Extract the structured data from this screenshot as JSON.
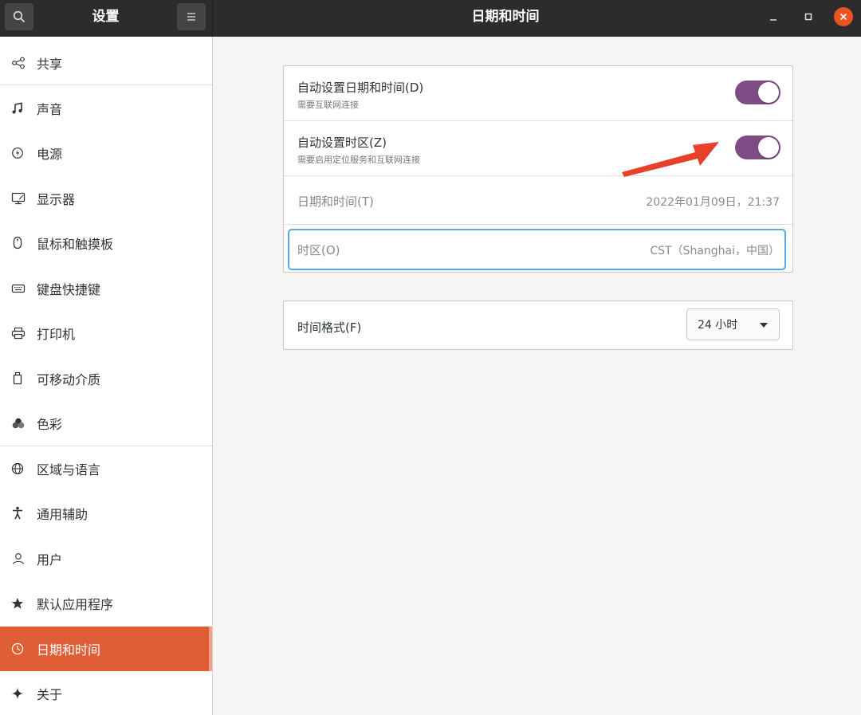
{
  "header": {
    "sidebar_title": "设置",
    "main_title": "日期和时间"
  },
  "sidebar": {
    "items": [
      {
        "label": "共享",
        "icon": "share-icon"
      },
      {
        "label": "声音",
        "icon": "music-note-icon"
      },
      {
        "label": "电源",
        "icon": "power-icon"
      },
      {
        "label": "显示器",
        "icon": "monitor-icon"
      },
      {
        "label": "鼠标和触摸板",
        "icon": "mouse-icon"
      },
      {
        "label": "键盘快捷键",
        "icon": "keyboard-icon"
      },
      {
        "label": "打印机",
        "icon": "printer-icon"
      },
      {
        "label": "可移动介质",
        "icon": "removable-media-icon"
      },
      {
        "label": "色彩",
        "icon": "color-icon"
      },
      {
        "label": "区域与语言",
        "icon": "globe-icon"
      },
      {
        "label": "通用辅助",
        "icon": "accessibility-icon"
      },
      {
        "label": "用户",
        "icon": "user-icon"
      },
      {
        "label": "默认应用程序",
        "icon": "star-icon"
      },
      {
        "label": "日期和时间",
        "icon": "clock-icon",
        "active": true
      },
      {
        "label": "关于",
        "icon": "sparkle-icon"
      }
    ]
  },
  "datetime": {
    "auto_datetime": {
      "title": "自动设置日期和时间(D)",
      "subtitle": "需要互联网连接",
      "enabled": true
    },
    "auto_timezone": {
      "title": "自动设置时区(Z)",
      "subtitle": "需要启用定位服务和互联网连接",
      "enabled": true
    },
    "date_time": {
      "label": "日期和时间(T)",
      "value": "2022年01月09日，21:37"
    },
    "timezone": {
      "label": "时区(O)",
      "value": "CST（Shanghai，中国）"
    }
  },
  "time_format": {
    "label": "时间格式(F)",
    "selected": "24 小时"
  },
  "colors": {
    "accent": "#e05e35",
    "switch_on": "#7e4b85",
    "focus": "#56a8e6",
    "annotation_arrow": "#e8412b"
  }
}
